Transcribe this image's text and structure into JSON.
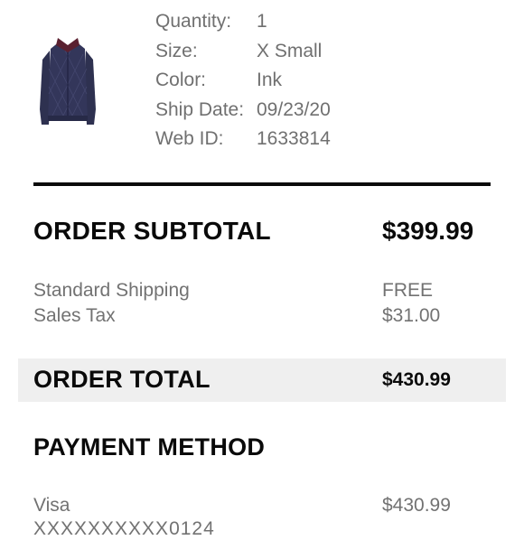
{
  "item": {
    "image_alt": "Ink quilted jacket",
    "details": [
      {
        "label": "Quantity:",
        "value": "1"
      },
      {
        "label": "Size:",
        "value": "X Small"
      },
      {
        "label": "Color:",
        "value": "Ink"
      },
      {
        "label": "Ship Date:",
        "value": "09/23/20"
      },
      {
        "label": "Web ID:",
        "value": "1633814"
      }
    ]
  },
  "summary": {
    "subtotal_label": "ORDER SUBTOTAL",
    "subtotal_value": "$399.99",
    "lines": [
      {
        "label": "Standard Shipping",
        "value": "FREE"
      },
      {
        "label": "Sales Tax",
        "value": "$31.00"
      }
    ],
    "total_label": "ORDER TOTAL",
    "total_value": "$430.99"
  },
  "payment": {
    "heading": "PAYMENT METHOD",
    "card_type": "Visa",
    "amount": "$430.99",
    "card_masked": "XXXXXXXXXX0124"
  },
  "colors": {
    "text_dark": "#0a0a0a",
    "text_muted": "#707070",
    "band": "#efefef",
    "jacket": "#2e3150"
  }
}
